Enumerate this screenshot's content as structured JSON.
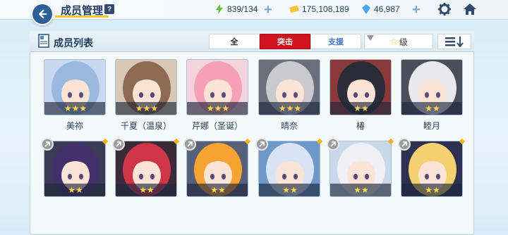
{
  "header": {
    "title": "成员管理",
    "help": "?",
    "stamina": "839/134",
    "credits": "175,108,189",
    "gems": "46,987"
  },
  "panel": {
    "title": "成员列表",
    "tabs": [
      "全",
      "突击",
      "支援"
    ],
    "active_tab": "突击",
    "sort_label": "级"
  },
  "members": [
    {
      "name": "美祢",
      "stars": "★★★",
      "hair": "#9ab8e0",
      "bg": "#c8d8f0"
    },
    {
      "name": "千夏（温泉）",
      "stars": "★★★",
      "hair": "#8e6a52",
      "bg": "#d9c8b8"
    },
    {
      "name": "芹娜（圣诞）",
      "stars": "★★★",
      "hair": "#f4a0b8",
      "bg": "#f3d4dc"
    },
    {
      "name": "晴奈",
      "stars": "★★★",
      "hair": "#c9c9cf",
      "bg": "#6a6f7c"
    },
    {
      "name": "椿",
      "stars": "★★",
      "hair": "#2a2c38",
      "bg": "#8a3a3a"
    },
    {
      "name": "睦月",
      "stars": "★★",
      "hair": "#e8e8ee",
      "bg": "#4c4e5a"
    },
    {
      "name": "",
      "stars": "★★",
      "hair": "#43306b",
      "bg": "#3a3c55"
    },
    {
      "name": "",
      "stars": "★★",
      "hair": "#d0354a",
      "bg": "#3b2b38"
    },
    {
      "name": "",
      "stars": "★★",
      "hair": "#f7a331",
      "bg": "#56607a"
    },
    {
      "name": "",
      "stars": "★★",
      "hair": "#d8e4f4",
      "bg": "#6d98c8"
    },
    {
      "name": "",
      "stars": "★★",
      "hair": "#f0f0f4",
      "bg": "#c9d8ea"
    },
    {
      "name": "",
      "stars": "★★",
      "hair": "#f4d071",
      "bg": "#2d3050"
    }
  ],
  "icons": [
    "back-arrow-icon",
    "help-icon",
    "stamina-icon",
    "credits-icon",
    "gem-icon",
    "plus-icon",
    "gear-icon",
    "home-icon",
    "list-icon",
    "sort-order-icon",
    "lock-icon"
  ]
}
